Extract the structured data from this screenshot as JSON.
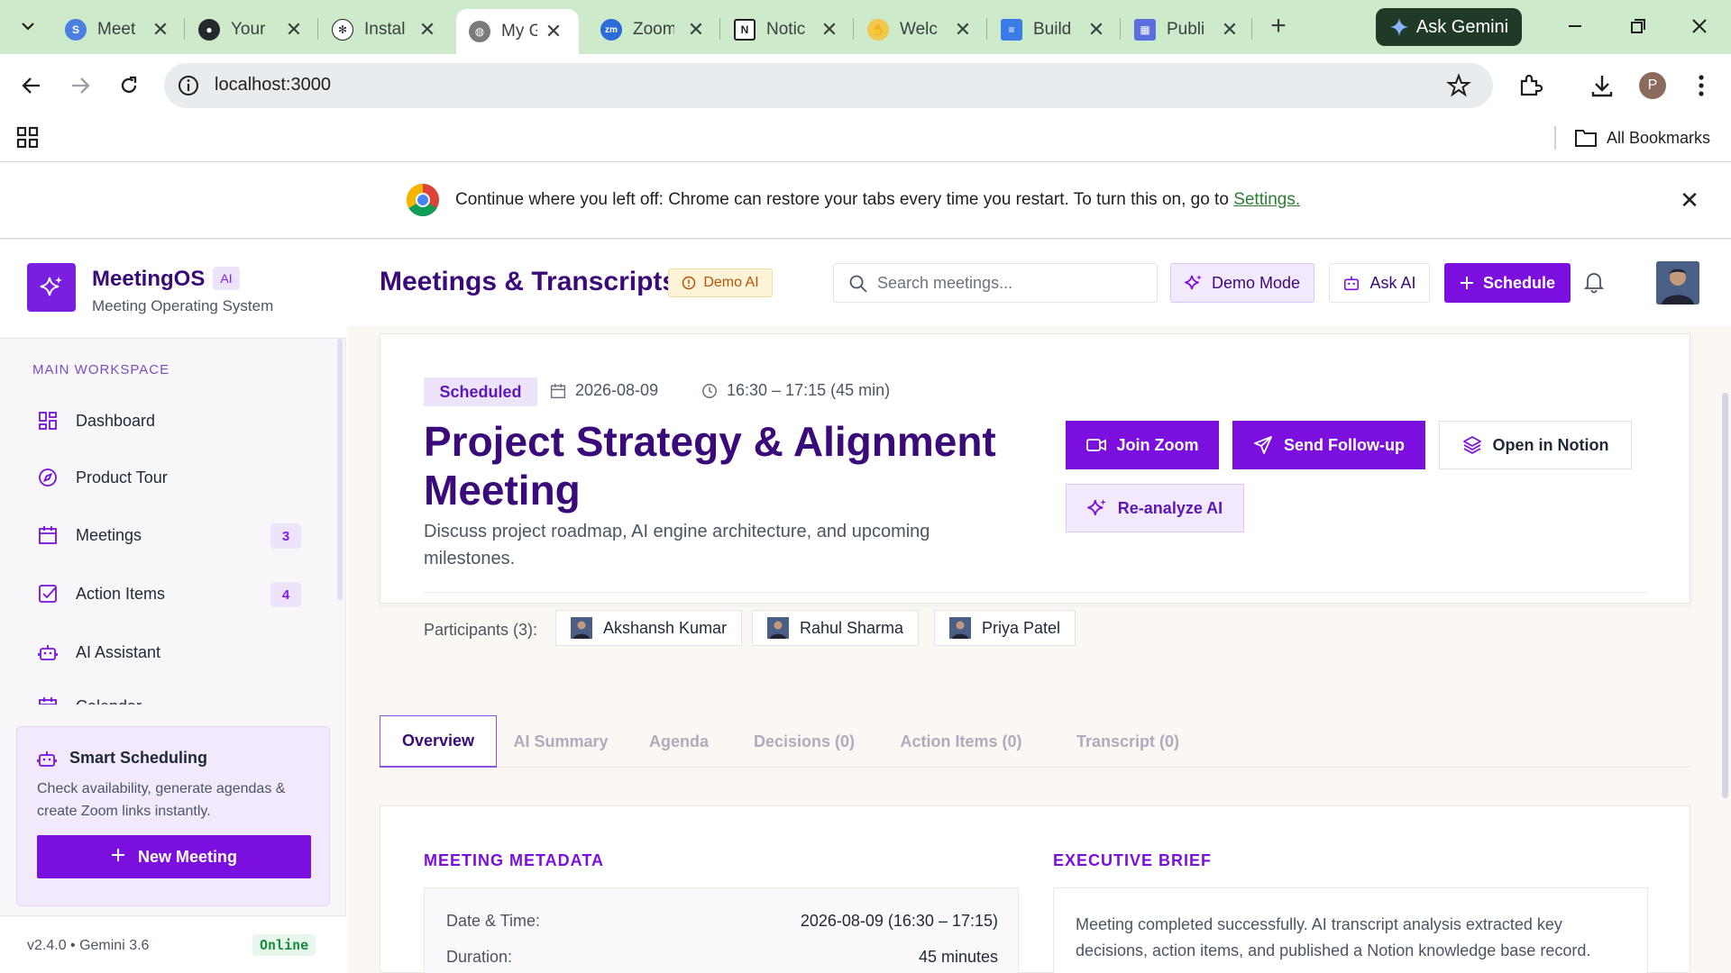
{
  "browser": {
    "tabs": [
      {
        "title": "Meet",
        "icon": "meet-icon"
      },
      {
        "title": "Your",
        "icon": "github-icon"
      },
      {
        "title": "Instal",
        "icon": "openai-icon"
      },
      {
        "title": "My G",
        "icon": "globe-icon",
        "active": true
      },
      {
        "title": "Zoom",
        "icon": "zoom-icon"
      },
      {
        "title": "Notic",
        "icon": "notion-icon"
      },
      {
        "title": "Welc",
        "icon": "wave-icon"
      },
      {
        "title": "Build",
        "icon": "docs-icon"
      },
      {
        "title": "Publi",
        "icon": "calendar-icon"
      }
    ],
    "gemini_label": "Ask Gemini",
    "url": "localhost:3000",
    "profile_initial": "P",
    "all_bookmarks": "All Bookmarks",
    "infobar": {
      "text": "Continue where you left off: Chrome can restore your tabs every time you restart. To turn this on, go to ",
      "link": "Settings."
    }
  },
  "sidebar": {
    "brand_name": "MeetingOS",
    "brand_badge": "AI",
    "brand_sub": "Meeting Operating System",
    "section_label": "MAIN WORKSPACE",
    "items": [
      {
        "label": "Dashboard",
        "icon": "dashboard-icon"
      },
      {
        "label": "Product Tour",
        "icon": "compass-icon"
      },
      {
        "label": "Meetings",
        "icon": "calendar-icon",
        "badge": "3"
      },
      {
        "label": "Action Items",
        "icon": "checkbox-icon",
        "badge": "4"
      },
      {
        "label": "AI Assistant",
        "icon": "robot-icon"
      },
      {
        "label": "Calendar",
        "icon": "calendar-icon"
      }
    ],
    "smart_card": {
      "title": "Smart Scheduling",
      "desc": "Check availability, generate agendas & create Zoom links instantly.",
      "button": "New Meeting"
    },
    "footer_version": "v2.4.0 • Gemini 3.6",
    "footer_status": "Online"
  },
  "topbar": {
    "title": "Meetings & Transcripts",
    "demo_chip": "Demo AI",
    "search_placeholder": "Search meetings...",
    "demo_mode": "Demo Mode",
    "ask_ai": "Ask AI",
    "schedule": "Schedule"
  },
  "meeting": {
    "status": "Scheduled",
    "date": "2026-08-09",
    "time": "16:30 – 17:15 (45 min)",
    "title": "Project Strategy & Alignment Meeting",
    "description": "Discuss project roadmap, AI engine architecture, and upcoming milestones.",
    "actions": {
      "join": "Join Zoom",
      "follow_up": "Send Follow-up",
      "notion": "Open in Notion",
      "reanalyze": "Re-analyze AI"
    },
    "participants_label": "Participants (3):",
    "participants": [
      "Akshansh Kumar",
      "Rahul Sharma",
      "Priya Patel"
    ]
  },
  "tabs": [
    "Overview",
    "AI Summary",
    "Agenda",
    "Decisions (0)",
    "Action Items (0)",
    "Transcript (0)"
  ],
  "overview": {
    "metadata_title": "MEETING METADATA",
    "rows": [
      {
        "label": "Date & Time:",
        "value": "2026-08-09 (16:30 – 17:15)"
      },
      {
        "label": "Duration:",
        "value": "45 minutes"
      }
    ],
    "brief_title": "EXECUTIVE BRIEF",
    "brief": "Meeting completed successfully. AI transcript analysis extracted key decisions, action items, and published a Notion knowledge base record."
  },
  "colors": {
    "brand": "#7a0fde",
    "brand_dark": "#3b0a7a",
    "tabbar": "#cdeaca",
    "online": "#1b8e3e"
  }
}
